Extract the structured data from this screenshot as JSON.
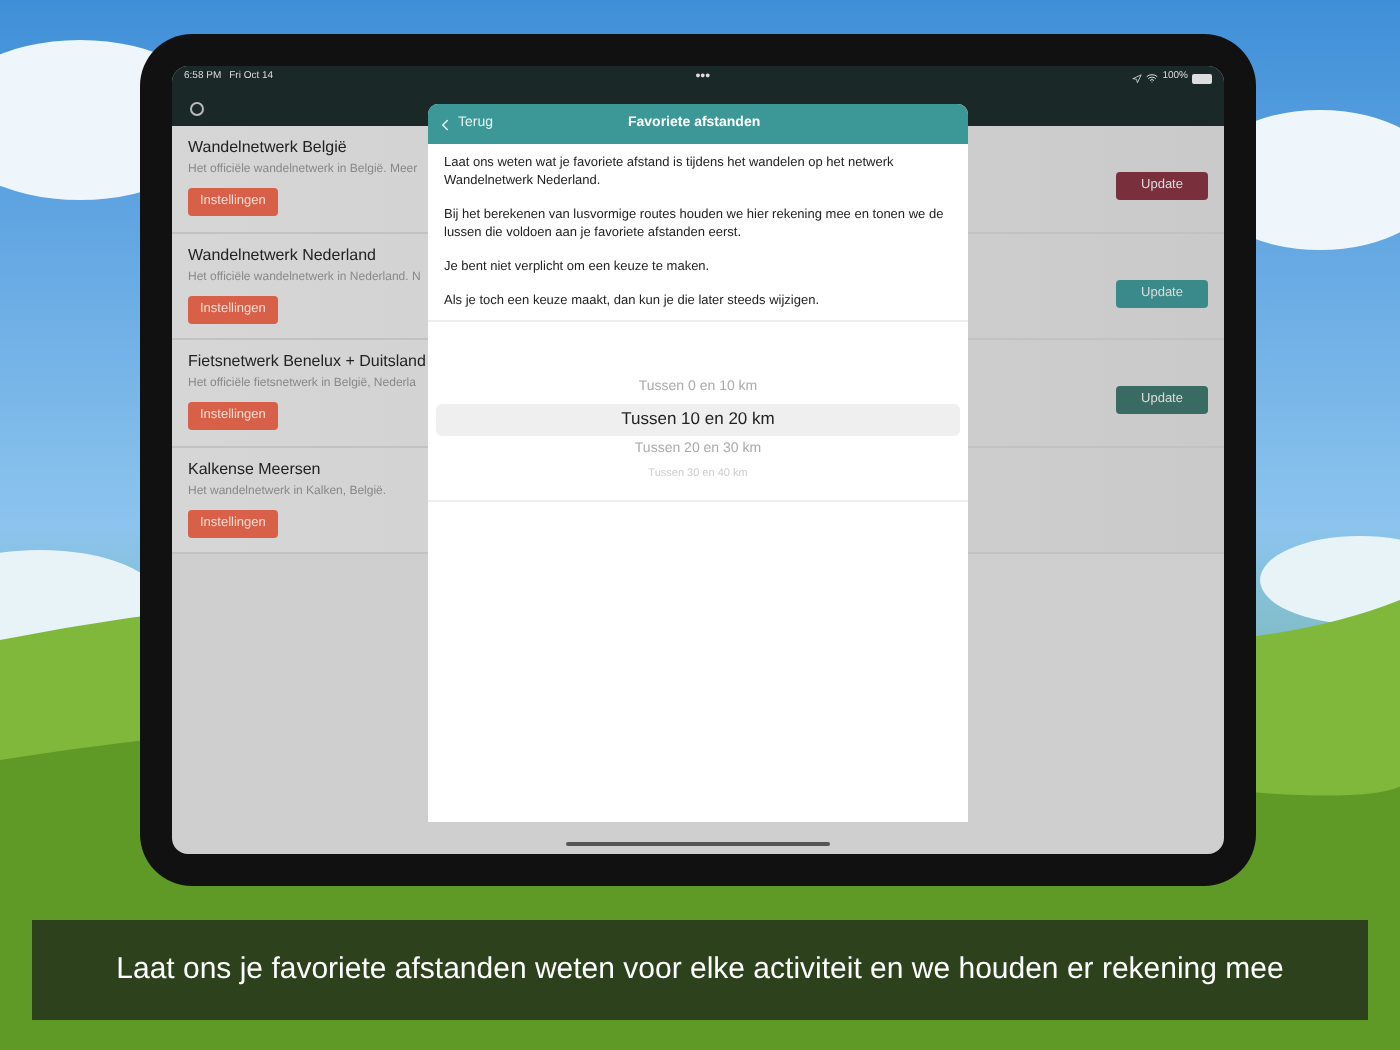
{
  "status_bar": {
    "time": "6:58 PM",
    "date": "Fri Oct 14",
    "dots": "•••",
    "battery": "100%"
  },
  "networks": [
    {
      "title": "Wandelnetwerk België",
      "description": "Het officiële wandelnetwerk in België. Meer",
      "settings_label": "Instellingen",
      "update": {
        "label": "Update",
        "color": "#7a2f3c"
      }
    },
    {
      "title": "Wandelnetwerk Nederland",
      "description": "Het officiële wandelnetwerk in Nederland. N",
      "settings_label": "Instellingen",
      "update": {
        "label": "Update",
        "color": "#3a8a8c"
      }
    },
    {
      "title": "Fietsnetwerk Benelux + Duitsland",
      "description": "Het officiële fietsnetwerk in België, Nederla",
      "settings_label": "Instellingen",
      "update": {
        "label": "Update",
        "color": "#3a6b63"
      }
    },
    {
      "title": "Kalkense Meersen",
      "description": "Het wandelnetwerk in Kalken, België.",
      "settings_label": "Instellingen"
    }
  ],
  "modal": {
    "back_label": "Terug",
    "title": "Favoriete afstanden",
    "paragraphs": [
      "Laat ons weten wat je favoriete afstand is tijdens het wandelen op het netwerk Wandelnetwerk Nederland.",
      "Bij het berekenen van lusvormige routes houden we hier rekening mee en tonen we de lussen die voldoen aan je favoriete afstanden eerst.",
      "Je bent niet verplicht om een keuze te maken.",
      "Als je toch een keuze maakt, dan kun je die later steeds wijzigen."
    ],
    "picker": [
      {
        "label": "Tussen 0 en 10 km",
        "selected": false
      },
      {
        "label": "Tussen 10 en 20 km",
        "selected": true
      },
      {
        "label": "Tussen 20 en 30 km",
        "selected": false
      },
      {
        "label": "Tussen 30 en 40 km",
        "selected": false
      }
    ]
  },
  "caption": "Laat ons je favoriete afstanden weten voor elke activiteit en we houden er rekening mee"
}
